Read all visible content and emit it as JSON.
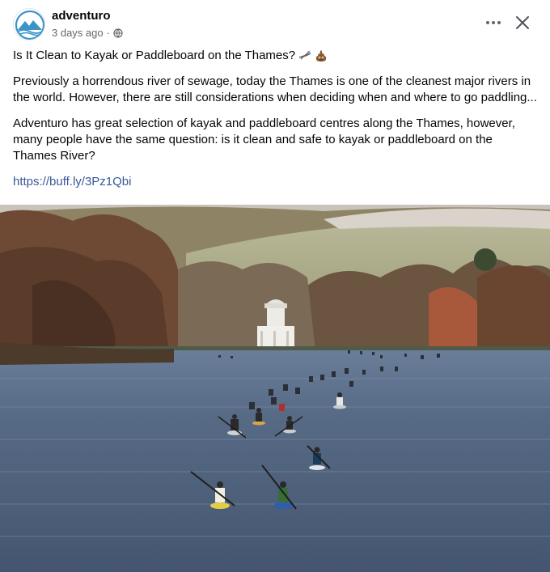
{
  "post": {
    "author": "adventuro",
    "timestamp": "3 days ago",
    "separator": "·",
    "audience_icon": "globe-icon",
    "title": "Is It Clean to Kayak or Paddleboard on the Thames?",
    "title_emojis": [
      "kayak-emoji",
      "poop-emoji"
    ],
    "paragraph_1": "Previously a horrendous river of sewage, today the Thames is one of the cleanest major rivers in the world. However, there are still considerations when deciding when and where to go paddling...",
    "paragraph_2": "Adventuro has great selection of kayak and paddleboard centres along the Thames, however, many people have the same question: is it clean and safe to kayak or paddleboard on the Thames River?",
    "link": "https://buff.ly/3Pz1Qbi"
  },
  "header_actions": {
    "more_icon": "more-horizontal-icon",
    "close_icon": "close-icon"
  },
  "photo": {
    "subject": "kayakers-on-thames-river-photo"
  },
  "colors": {
    "link": "#385898",
    "meta_text": "#65676b",
    "brand_logo": "#3b93c8"
  }
}
